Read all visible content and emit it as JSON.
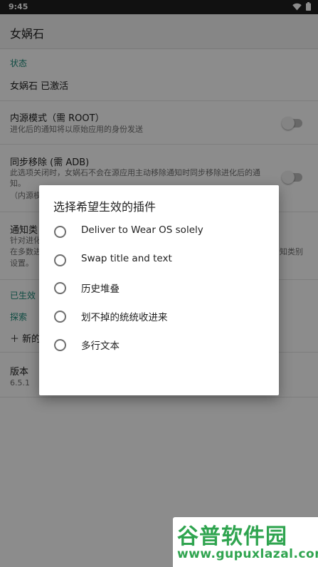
{
  "status_bar": {
    "time": "9:45"
  },
  "app_bar": {
    "title": "女娲石"
  },
  "sections": {
    "status_header": "状态",
    "status_text": "女娲石 已激活",
    "inner_mode_title": "内源模式（需 ROOT）",
    "inner_mode_summary": "进化后的通知将以原始应用的身份发送",
    "sync_remove_title": "同步移除 (需 ADB)",
    "sync_remove_summary": "此选项关闭时，女娲石不会在源应用主动移除通知时同步移除进化后的通知。",
    "sync_remove_summary_extra": "（内源模",
    "notify_cat_title": "通知类",
    "notify_cat_summary_1": "针对进化",
    "notify_cat_summary_2": "在多数进",
    "notify_cat_summary_right": "知类别",
    "notify_cat_summary_3": "设置。",
    "effective_header": "已生效",
    "explore_header": "探索",
    "new_item": "＋ 新的",
    "version_title": "版本",
    "version_value": "6.5.1"
  },
  "dialog": {
    "title": "选择希望生效的插件",
    "options": [
      {
        "label": "Deliver to Wear OS solely",
        "selected": false
      },
      {
        "label": "Swap title and text",
        "selected": false
      },
      {
        "label": "历史堆叠",
        "selected": false
      },
      {
        "label": "划不掉的统统收进来",
        "selected": false
      },
      {
        "label": "多行文本",
        "selected": false
      }
    ]
  },
  "watermark": {
    "logo": "谷普软件园",
    "url": "www.gupuxlazal.com"
  },
  "colors": {
    "accent": "#1e8a7a",
    "watermark": "#2fa44f"
  }
}
